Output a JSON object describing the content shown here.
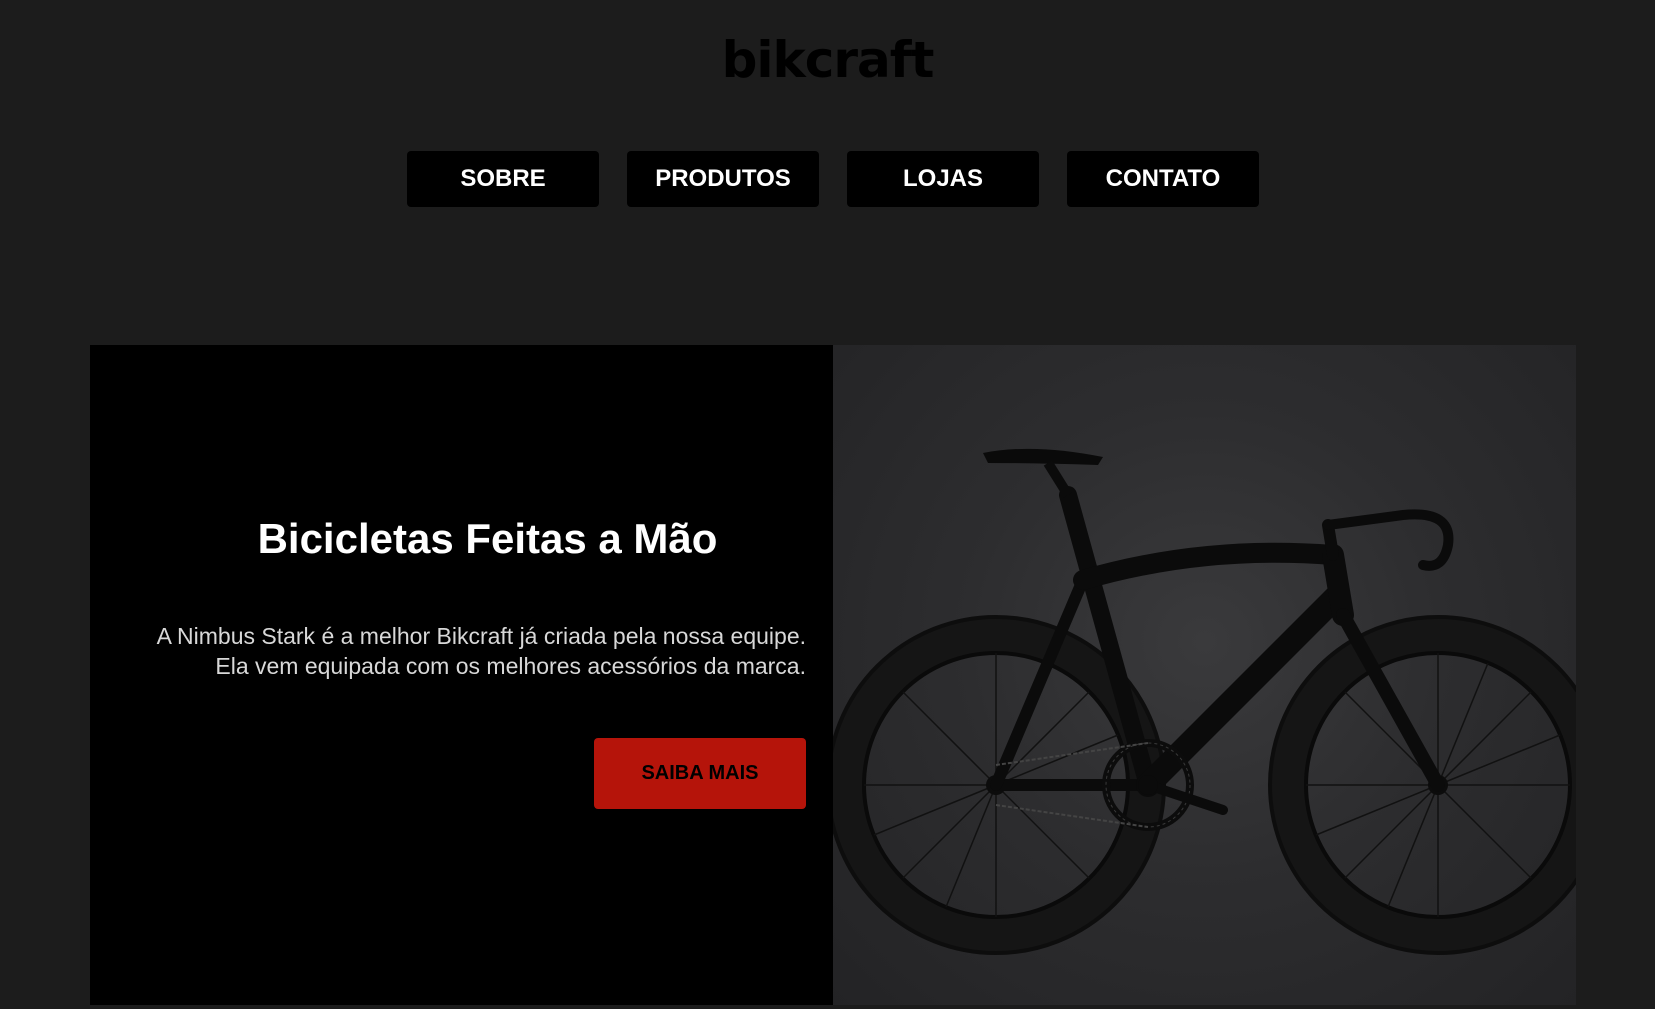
{
  "header": {
    "logo": "bikcraft"
  },
  "nav": {
    "items": [
      {
        "label": "SOBRE"
      },
      {
        "label": "PRODUTOS"
      },
      {
        "label": "LOJAS"
      },
      {
        "label": "CONTATO"
      }
    ]
  },
  "hero": {
    "title": "Bicicletas Feitas a Mão",
    "description": "A Nimbus Stark é a melhor Bikcraft já criada pela nossa equipe. Ela vem equipada com os melhores acessórios da marca.",
    "cta_label": "SAIBA MAIS",
    "image_alt": "bicycle"
  },
  "colors": {
    "background": "#1c1c1c",
    "panel": "#000000",
    "accent": "#b5140a",
    "text": "#ffffff"
  }
}
